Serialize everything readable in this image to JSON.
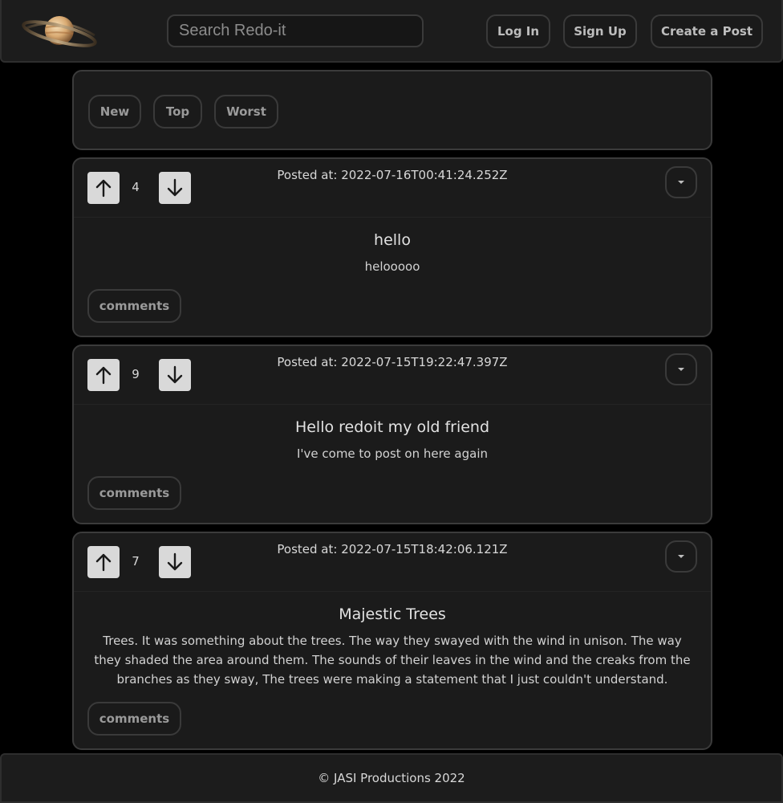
{
  "header": {
    "logo_icon": "saturn-planet-icon",
    "search_placeholder": "Search Redo-it",
    "login_label": "Log In",
    "signup_label": "Sign Up",
    "create_label": "Create a Post"
  },
  "sort": {
    "new_label": "New",
    "top_label": "Top",
    "worst_label": "Worst"
  },
  "posts": [
    {
      "votes": "4",
      "posted_at": "Posted at: 2022-07-16T00:41:24.252Z",
      "title": "hello",
      "body": "helooooo",
      "comments_label": "comments"
    },
    {
      "votes": "9",
      "posted_at": "Posted at: 2022-07-15T19:22:47.397Z",
      "title": "Hello redoit my old friend",
      "body": "I've come to post on here again",
      "comments_label": "comments"
    },
    {
      "votes": "7",
      "posted_at": "Posted at: 2022-07-15T18:42:06.121Z",
      "title": "Majestic Trees",
      "body": "Trees. It was something about the trees. The way they swayed with the wind in unison. The way they shaded the area around them. The sounds of their leaves in the wind and the creaks from the branches as they sway, The trees were making a statement that I just couldn't understand.",
      "comments_label": "comments"
    }
  ],
  "footer": {
    "text": "© JASI Productions 2022"
  },
  "icons": {
    "upvote": "arrow-up-icon",
    "downvote": "arrow-down-icon",
    "menu": "chevron-down-icon"
  },
  "colors": {
    "background": "#000000",
    "panel": "#1b1b1b",
    "border": "#3b3b3b",
    "vote_button": "#d9d9d9"
  }
}
